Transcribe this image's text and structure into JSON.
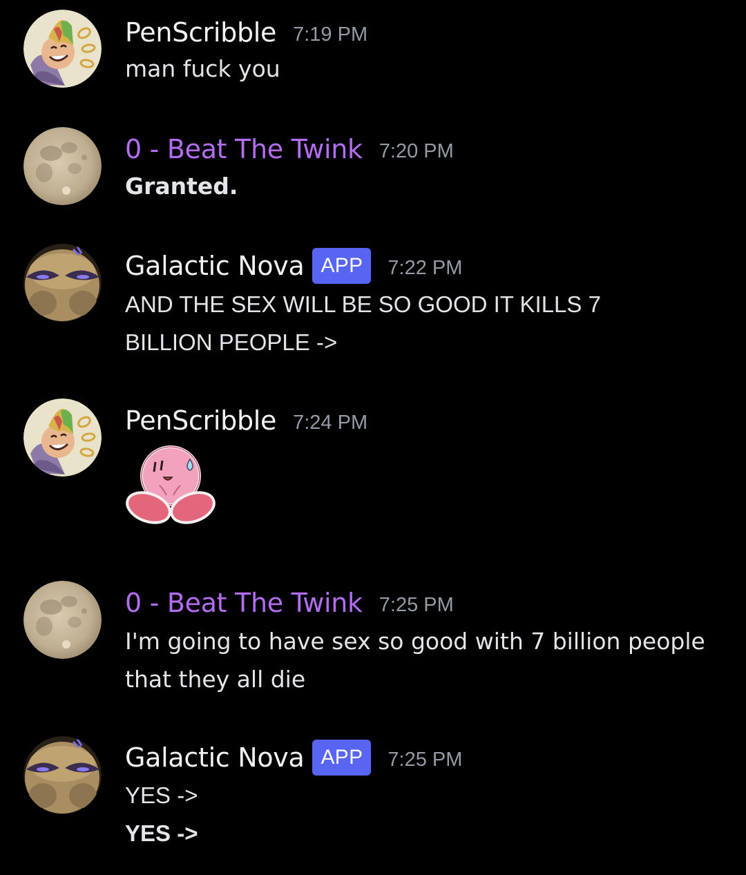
{
  "messages": [
    {
      "author": "PenScribble",
      "author_color": "#f2f3f5",
      "time": "7:19 PM",
      "avatar": "penscribble-avatar",
      "lines": [
        "man fuck you"
      ]
    },
    {
      "author": "0 - Beat The Twink",
      "author_color": "#b36df0",
      "time": "7:20 PM",
      "avatar": "moon-avatar",
      "lines": [
        "Granted."
      ]
    },
    {
      "author": "Galactic Nova",
      "author_color": "#f2f3f5",
      "tag": "APP",
      "time": "7:22 PM",
      "avatar": "galactic-nova-avatar",
      "lines": [
        "AND THE SEX WILL BE SO GOOD IT KILLS 7",
        "BILLION PEOPLE ->"
      ]
    },
    {
      "author": "PenScribble",
      "author_color": "#f2f3f5",
      "time": "7:24 PM",
      "avatar": "penscribble-avatar",
      "emoji": "kirby-sweat-emoji"
    },
    {
      "author": "0 - Beat The Twink",
      "author_color": "#b36df0",
      "time": "7:25 PM",
      "avatar": "moon-avatar",
      "lines": [
        "I'm going to have sex so good with 7 billion people",
        "that they all die"
      ]
    },
    {
      "author": "Galactic Nova",
      "author_color": "#f2f3f5",
      "tag": "APP",
      "time": "7:25 PM",
      "avatar": "galactic-nova-avatar",
      "lines": [
        "YES ->",
        "YES ->"
      ]
    }
  ],
  "colors": {
    "background": "#000000",
    "app_tag": "#5865f2",
    "timestamp": "#949ba4"
  }
}
